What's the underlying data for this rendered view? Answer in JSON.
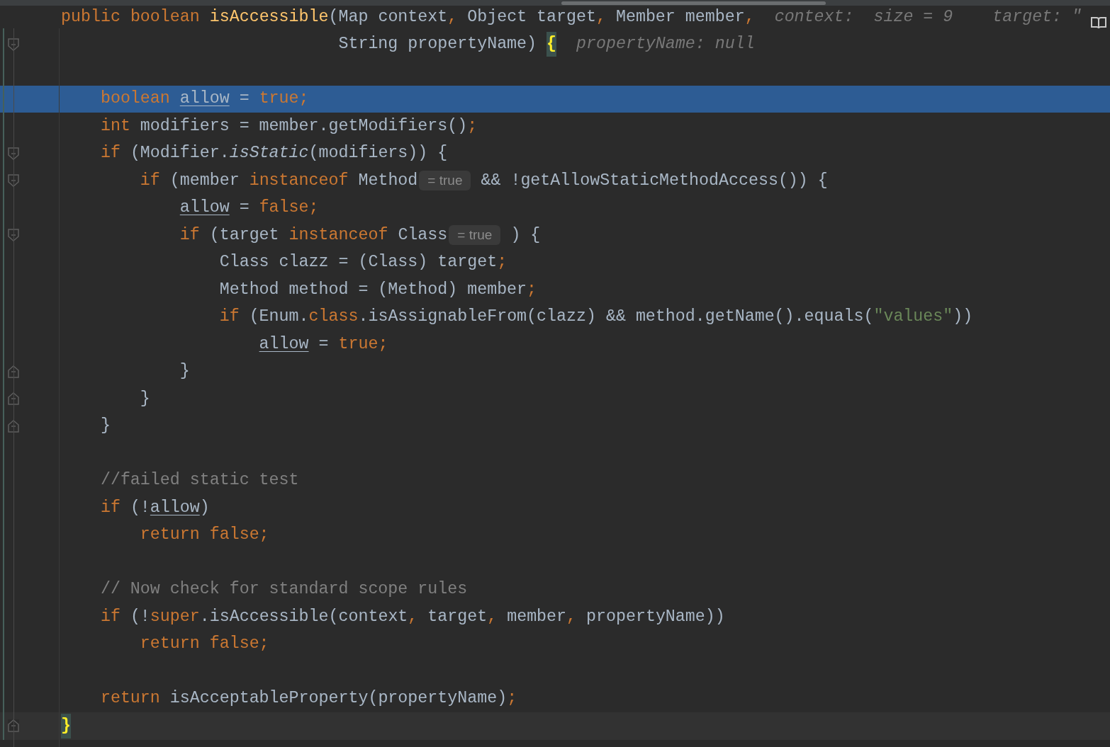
{
  "editor": {
    "blocks": [
      {
        "lines": [
          {
            "tokens": [
              {
                "kind": "kw",
                "text": "public "
              },
              {
                "kind": "kw",
                "text": "boolean "
              },
              {
                "kind": "decl",
                "text": "isAccessible"
              },
              {
                "kind": "id",
                "text": "(Map context"
              },
              {
                "kind": "punct",
                "text": ","
              },
              {
                "kind": "id",
                "text": " Object target"
              },
              {
                "kind": "punct",
                "text": ","
              },
              {
                "kind": "id",
                "text": " Member member"
              },
              {
                "kind": "punct",
                "text": ","
              },
              {
                "kind": "hint",
                "text": "  context:  size = 9"
              },
              {
                "kind": "hint",
                "text": "    target: \""
              }
            ]
          },
          {
            "fold_start": true,
            "tokens": [
              {
                "kind": "id",
                "text": "                            String propertyName) "
              },
              {
                "kind": "brace",
                "text": "{"
              },
              {
                "kind": "hint",
                "text": "  propertyName: null"
              }
            ]
          }
        ]
      },
      {
        "lines": [
          {
            "execution_point": true,
            "tokens": [
              {
                "kind": "kw",
                "text": "    boolean "
              },
              {
                "kind": "var",
                "text": "allow"
              },
              {
                "kind": "id",
                "text": " = "
              },
              {
                "kind": "kw",
                "text": "true"
              },
              {
                "kind": "punct",
                "text": ";"
              }
            ]
          },
          {
            "tokens": [
              {
                "kind": "kw",
                "text": "    int"
              },
              {
                "kind": "id",
                "text": " modifiers = member.getModifiers()"
              },
              {
                "kind": "punct",
                "text": ";"
              }
            ]
          },
          {
            "fold_start": true,
            "tokens": [
              {
                "kind": "kw",
                "text": "    if"
              },
              {
                "kind": "id",
                "text": " (Modifier."
              },
              {
                "kind": "static",
                "text": "isStatic"
              },
              {
                "kind": "id",
                "text": "(modifiers)) {"
              }
            ]
          },
          {
            "fold_start": true,
            "tokens": [
              {
                "kind": "kw",
                "text": "        if"
              },
              {
                "kind": "id",
                "text": " (member "
              },
              {
                "kind": "kw",
                "text": "instanceof"
              },
              {
                "kind": "id",
                "text": " Method"
              },
              {
                "kind": "inlay",
                "text": "= true"
              },
              {
                "kind": "id",
                "text": "&& !getAllowStaticMethodAccess()) {"
              }
            ]
          },
          {
            "tokens": [
              {
                "kind": "var",
                "text": "            allow"
              },
              {
                "kind": "id",
                "text": " = "
              },
              {
                "kind": "kw",
                "text": "false"
              },
              {
                "kind": "punct",
                "text": ";"
              }
            ]
          },
          {
            "fold_start": true,
            "tokens": [
              {
                "kind": "kw",
                "text": "            if"
              },
              {
                "kind": "id",
                "text": " (target "
              },
              {
                "kind": "kw",
                "text": "instanceof"
              },
              {
                "kind": "id",
                "text": " Class"
              },
              {
                "kind": "inlay",
                "text": "= true"
              },
              {
                "kind": "id",
                "text": ") {"
              }
            ]
          },
          {
            "tokens": [
              {
                "kind": "id",
                "text": "                Class clazz = (Class) target"
              },
              {
                "kind": "punct",
                "text": ";"
              }
            ]
          },
          {
            "tokens": [
              {
                "kind": "id",
                "text": "                Method method = (Method) member"
              },
              {
                "kind": "punct",
                "text": ";"
              }
            ]
          },
          {
            "tokens": [
              {
                "kind": "kw",
                "text": "                if"
              },
              {
                "kind": "id",
                "text": " (Enum."
              },
              {
                "kind": "kw",
                "text": "class"
              },
              {
                "kind": "id",
                "text": ".isAssignableFrom(clazz) && method.getName().equals("
              },
              {
                "kind": "str",
                "text": "\"values\""
              },
              {
                "kind": "id",
                "text": "))"
              }
            ]
          },
          {
            "tokens": [
              {
                "kind": "var",
                "text": "                    allow"
              },
              {
                "kind": "id",
                "text": " = "
              },
              {
                "kind": "kw",
                "text": "true"
              },
              {
                "kind": "punct",
                "text": ";"
              }
            ]
          },
          {
            "fold_end": true,
            "tokens": [
              {
                "kind": "id",
                "text": "            }"
              }
            ]
          },
          {
            "fold_end": true,
            "tokens": [
              {
                "kind": "id",
                "text": "        }"
              }
            ]
          },
          {
            "fold_end": true,
            "tokens": [
              {
                "kind": "id",
                "text": "    }"
              }
            ]
          }
        ]
      },
      {
        "lines": [
          {
            "tokens": [
              {
                "kind": "cmt",
                "text": "    //failed static test"
              }
            ]
          },
          {
            "tokens": [
              {
                "kind": "kw",
                "text": "    if"
              },
              {
                "kind": "id",
                "text": " (!"
              },
              {
                "kind": "var",
                "text": "allow"
              },
              {
                "kind": "id",
                "text": ")"
              }
            ]
          },
          {
            "tokens": [
              {
                "kind": "kw",
                "text": "        return false"
              },
              {
                "kind": "punct",
                "text": ";"
              }
            ]
          }
        ]
      },
      {
        "lines": [
          {
            "tokens": [
              {
                "kind": "cmt",
                "text": "    // Now check for standard scope rules"
              }
            ]
          },
          {
            "tokens": [
              {
                "kind": "kw",
                "text": "    if"
              },
              {
                "kind": "id",
                "text": " (!"
              },
              {
                "kind": "kw",
                "text": "super"
              },
              {
                "kind": "id",
                "text": ".isAccessible(context"
              },
              {
                "kind": "punct",
                "text": ","
              },
              {
                "kind": "id",
                "text": " target"
              },
              {
                "kind": "punct",
                "text": ","
              },
              {
                "kind": "id",
                "text": " member"
              },
              {
                "kind": "punct",
                "text": ","
              },
              {
                "kind": "id",
                "text": " propertyName))"
              }
            ]
          },
          {
            "tokens": [
              {
                "kind": "kw",
                "text": "        return false"
              },
              {
                "kind": "punct",
                "text": ";"
              }
            ]
          }
        ]
      },
      {
        "lines": [
          {
            "tokens": [
              {
                "kind": "kw",
                "text": "    return"
              },
              {
                "kind": "id",
                "text": " isAcceptableProperty(propertyName)"
              },
              {
                "kind": "punct",
                "text": ";"
              }
            ]
          },
          {
            "fold_end": true,
            "caret_line": true,
            "tokens": [
              {
                "kind": "brace",
                "text": "}"
              }
            ]
          }
        ]
      }
    ]
  }
}
